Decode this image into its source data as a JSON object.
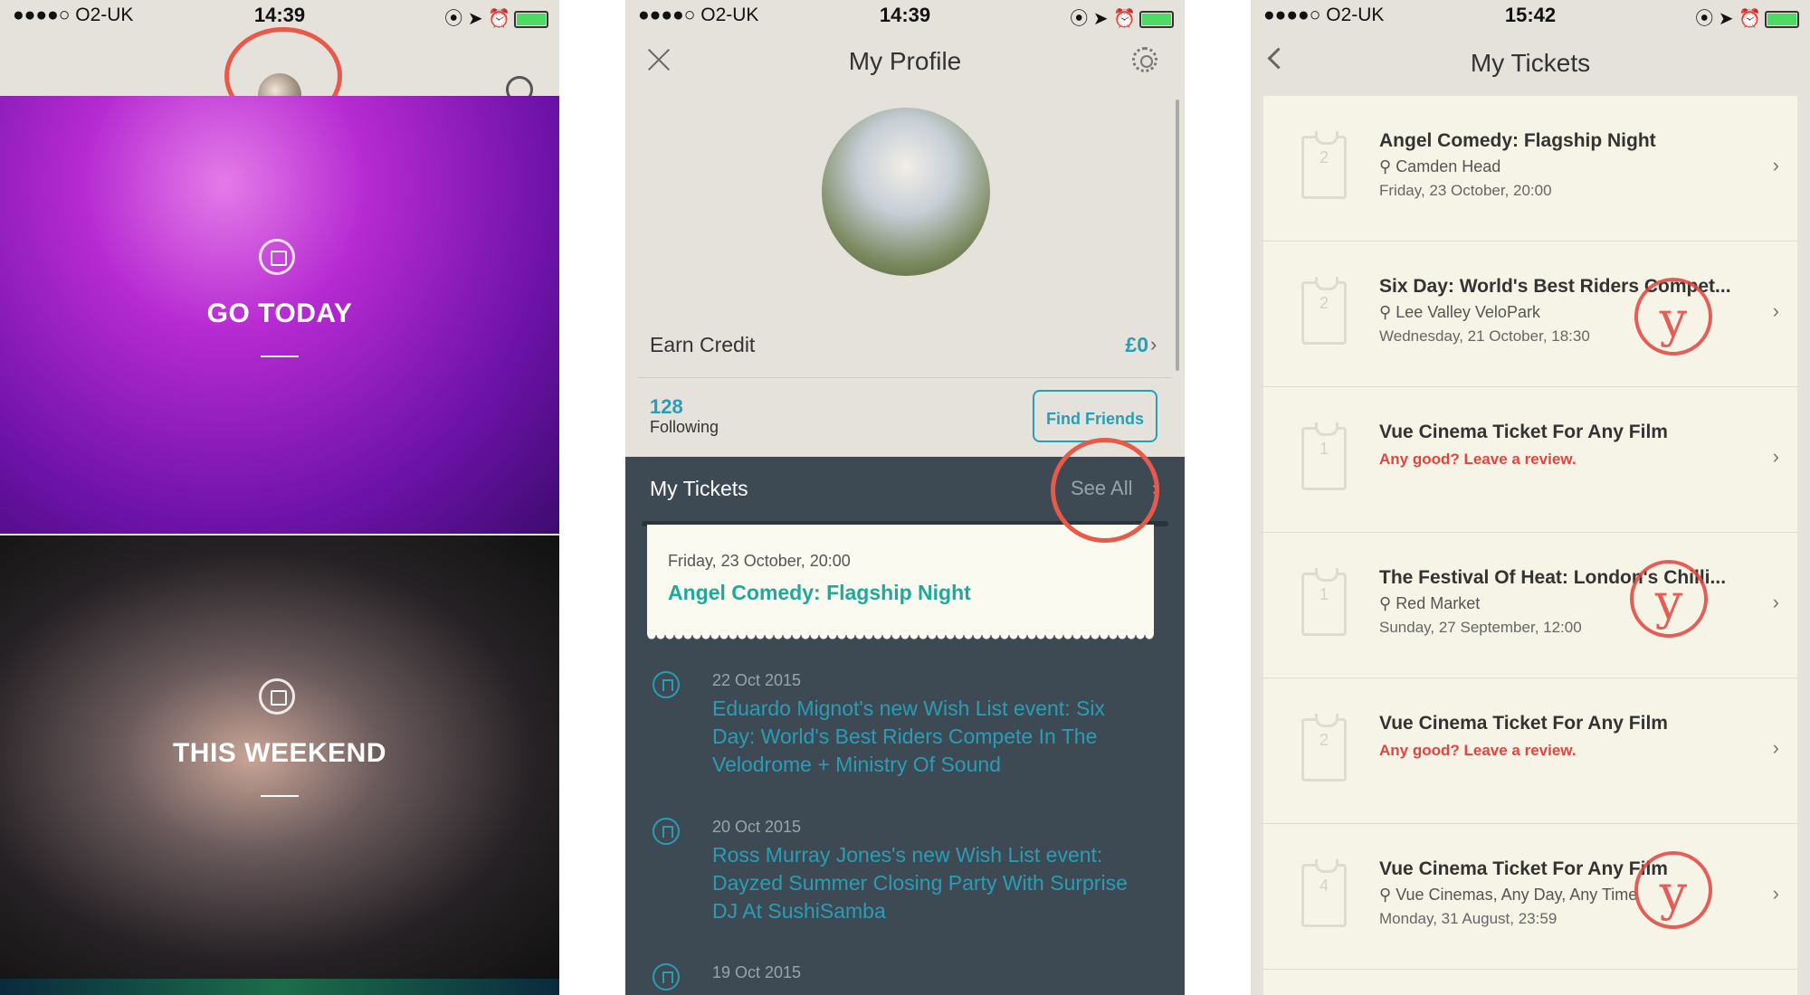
{
  "colors": {
    "accent": "#2a9db6",
    "teal": "#20a89b",
    "highlight": "#e8594a",
    "review": "#e2453f",
    "dark_panel": "#3d4a53"
  },
  "status_bar": {
    "phone1": {
      "carrier": "●●●●○ O2-UK",
      "time": "14:39"
    },
    "phone2": {
      "carrier": "●●●●○ O2-UK",
      "time": "14:39"
    },
    "phone3": {
      "carrier": "●●●●○ O2-UK",
      "time": "15:42"
    }
  },
  "home": {
    "tiles": [
      {
        "label": "GO TODAY"
      },
      {
        "label": "THIS WEEKEND"
      }
    ]
  },
  "profile": {
    "title": "My Profile",
    "earn_credit_label": "Earn Credit",
    "earn_credit_value": "£0",
    "following_count": "128",
    "following_label": "Following",
    "find_friends_label": "Find Friends",
    "my_tickets_label": "My Tickets",
    "see_all_label": "See All",
    "next_ticket": {
      "date": "Friday, 23 October, 20:00",
      "title": "Angel Comedy: Flagship Night"
    },
    "feed": [
      {
        "date": "22 Oct 2015",
        "text": "Eduardo Mignot's new Wish List event: Six Day: World's Best Riders Compete In The Velodrome + Ministry Of Sound"
      },
      {
        "date": "20 Oct 2015",
        "text": "Ross Murray Jones's new Wish List event: Dayzed Summer Closing Party With Surprise DJ At SushiSamba"
      },
      {
        "date": "19 Oct 2015",
        "text": ""
      }
    ]
  },
  "tickets": {
    "title": "My Tickets",
    "items": [
      {
        "qty": "2",
        "name": "Angel Comedy: Flagship Night",
        "venue": "Camden Head",
        "when": "Friday, 23 October, 20:00",
        "review": ""
      },
      {
        "qty": "2",
        "name": "Six Day: World's Best Riders Compet...",
        "venue": "Lee Valley VeloPark",
        "when": "Wednesday, 21 October, 18:30",
        "review": ""
      },
      {
        "qty": "1",
        "name": "Vue Cinema Ticket For Any Film",
        "venue": "",
        "when": "",
        "review": "Any good? Leave a review."
      },
      {
        "qty": "1",
        "name": "The Festival Of Heat: London's Chilli...",
        "venue": "Red Market",
        "when": "Sunday, 27 September, 12:00",
        "review": ""
      },
      {
        "qty": "2",
        "name": "Vue Cinema Ticket For Any Film",
        "venue": "",
        "when": "",
        "review": "Any good? Leave a review."
      },
      {
        "qty": "4",
        "name": "Vue Cinema Ticket For Any Film",
        "venue": "Vue Cinemas, Any Day, Any Time",
        "when": "Monday, 31 August, 23:59",
        "review": ""
      }
    ]
  },
  "icons": [
    "avatar",
    "search-icon",
    "calendar-icon",
    "close-icon",
    "gear-icon",
    "chevron-right-icon",
    "bookmark-icon",
    "back-icon",
    "ticket-icon",
    "pin-icon",
    "stamp-logo"
  ]
}
